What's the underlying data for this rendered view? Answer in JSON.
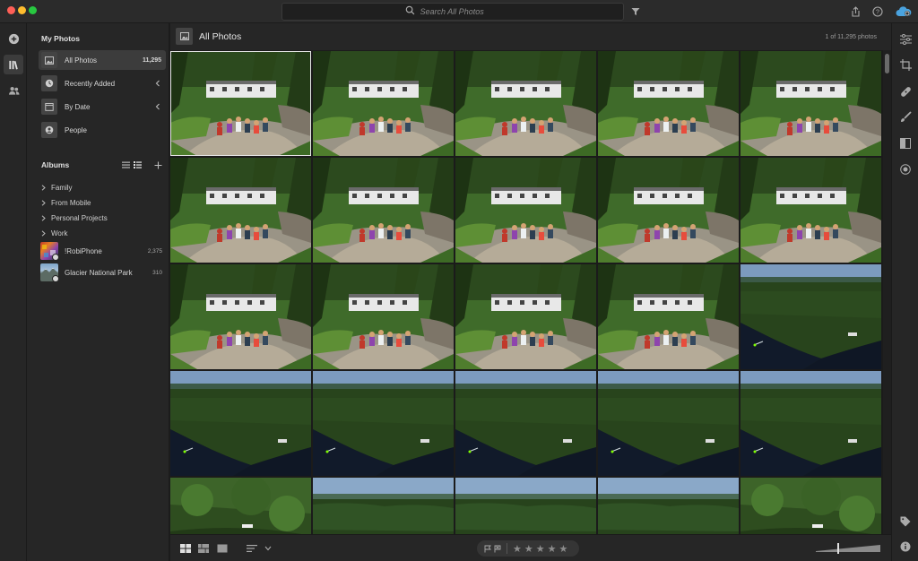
{
  "search": {
    "placeholder": "Search All Photos"
  },
  "sidebar": {
    "my_photos_title": "My Photos",
    "items": [
      {
        "label": "All Photos",
        "count": "11,295",
        "icon": "photos-icon",
        "active": true
      },
      {
        "label": "Recently Added",
        "icon": "clock-icon"
      },
      {
        "label": "By Date",
        "icon": "calendar-icon"
      },
      {
        "label": "People",
        "icon": "person-icon"
      }
    ],
    "albums_title": "Albums",
    "folders": [
      {
        "label": "Family"
      },
      {
        "label": "From Mobile"
      },
      {
        "label": "Personal Projects"
      },
      {
        "label": "Work"
      }
    ],
    "albums": [
      {
        "label": "!RobiPhone",
        "count": "2,375"
      },
      {
        "label": "Glacier National Park",
        "count": "310"
      }
    ]
  },
  "main": {
    "title": "All Photos",
    "photo_count": "1 of 11,295 photos"
  },
  "grid": {
    "rows": [
      [
        "group",
        "group",
        "group",
        "group",
        "group"
      ],
      [
        "group",
        "group",
        "group",
        "group",
        "group"
      ],
      [
        "group",
        "group",
        "group",
        "group",
        "aerial"
      ],
      [
        "aerial",
        "aerial",
        "aerial",
        "aerial",
        "aerial"
      ],
      [
        "forest",
        "forest-sky",
        "forest-sky",
        "forest-sky",
        "forest"
      ]
    ],
    "selected_index": 0
  },
  "rating": {
    "stars": [
      "★",
      "★",
      "★",
      "★",
      "★"
    ]
  },
  "colors": {
    "accent": "#e6e6e6",
    "cloud_accent": "#4aa3df"
  }
}
